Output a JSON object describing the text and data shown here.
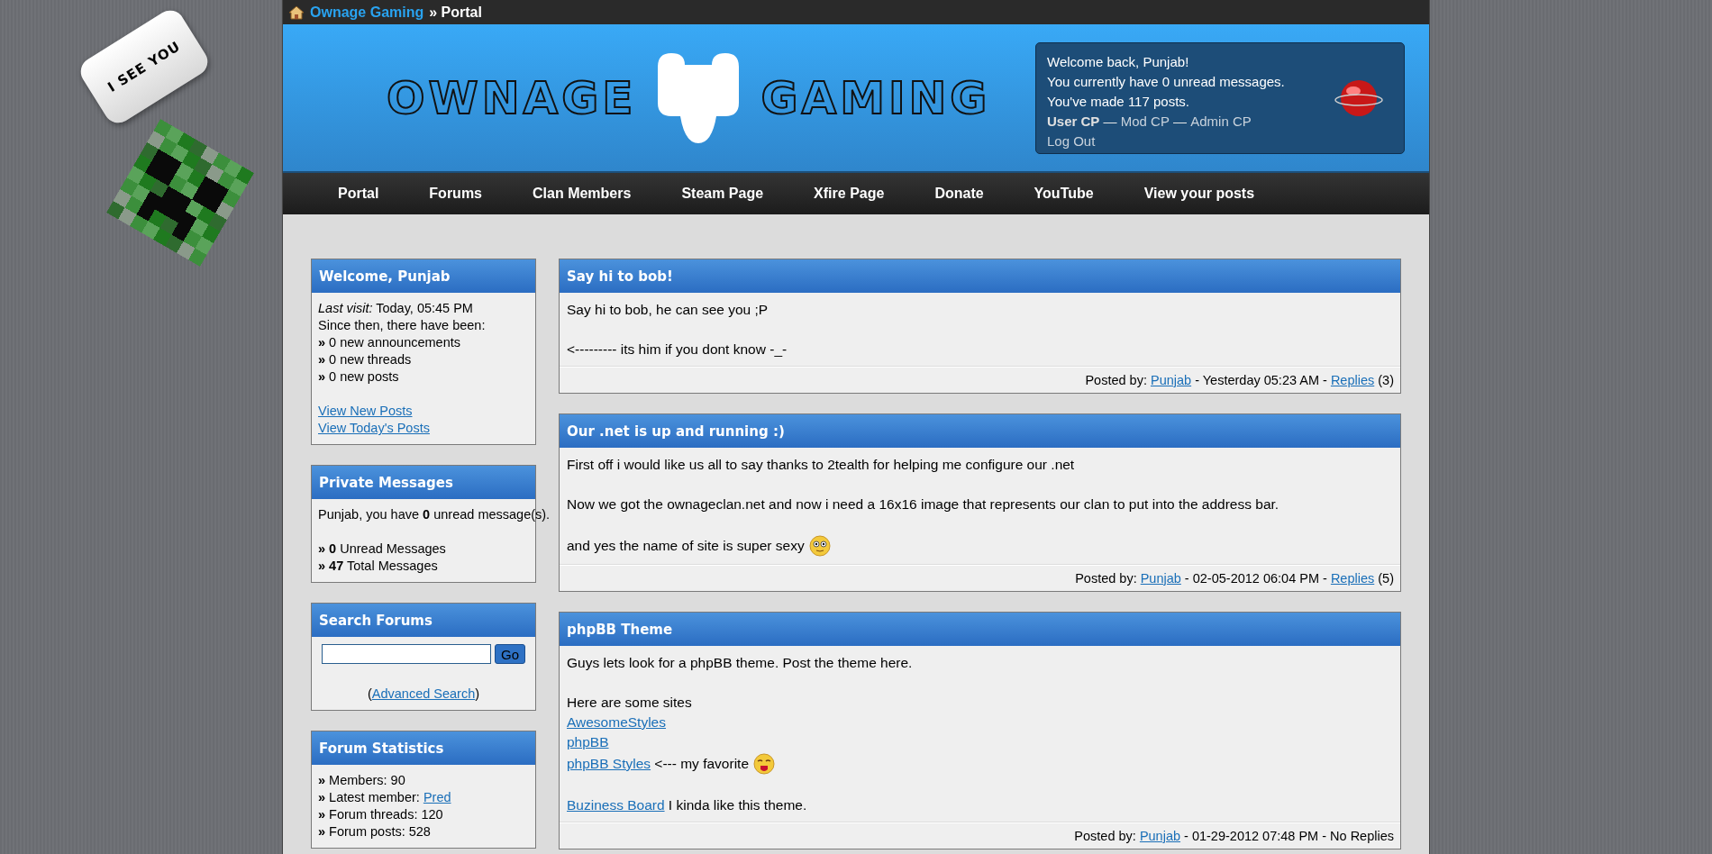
{
  "decor": {
    "bubble_text": "I SEE YOU"
  },
  "breadcrumb": {
    "site": "Ownage Gaming",
    "current": "» Portal"
  },
  "header": {
    "logo_left": "OWNAGE",
    "logo_right": "GAMING",
    "welcome_lines": [
      "Welcome back, Punjab!",
      "You currently have 0 unread messages.",
      "You've made 117 posts."
    ],
    "cp_links": [
      {
        "kind": "strong",
        "text": "User CP"
      },
      {
        "kind": "text",
        "text": " — "
      },
      {
        "kind": "link",
        "text": "Mod CP"
      },
      {
        "kind": "text",
        "text": " — "
      },
      {
        "kind": "link",
        "text": "Admin CP"
      }
    ],
    "logout": "Log Out"
  },
  "nav": [
    "Portal",
    "Forums",
    "Clan Members",
    "Steam Page",
    "Xfire Page",
    "Donate",
    "YouTube",
    "View your posts"
  ],
  "sidebar": [
    {
      "title": "Welcome, Punjab",
      "kind": "lines",
      "groups": [
        [
          [
            {
              "kind": "text",
              "text": "*Last visit:* Today, 05:45 PM"
            }
          ],
          [
            {
              "kind": "text",
              "text": "Since then, there have been:"
            }
          ],
          [
            {
              "kind": "text",
              "text": "**»** 0 new announcements"
            }
          ],
          [
            {
              "kind": "text",
              "text": "**»** 0 new threads"
            }
          ],
          [
            {
              "kind": "text",
              "text": "**»** 0 new posts"
            }
          ]
        ],
        [
          [
            {
              "kind": "link",
              "text": "View New Posts"
            }
          ],
          [
            {
              "kind": "link",
              "text": "View Today's Posts"
            }
          ]
        ]
      ]
    },
    {
      "title": "Private Messages",
      "kind": "lines",
      "groups": [
        [
          [
            {
              "kind": "text",
              "text": "Punjab, you have **0** unread message(s)."
            }
          ]
        ],
        [
          [
            {
              "kind": "text",
              "text": "**» 0** Unread Messages"
            }
          ],
          [
            {
              "kind": "text",
              "text": "**» 47** Total Messages"
            }
          ]
        ]
      ]
    },
    {
      "title": "Search Forums",
      "kind": "search",
      "button": "Go",
      "footer": [
        {
          "kind": "text",
          "text": "("
        },
        {
          "kind": "link",
          "text": "Advanced Search"
        },
        {
          "kind": "text",
          "text": ")"
        }
      ]
    },
    {
      "title": "Forum Statistics",
      "kind": "lines",
      "groups": [
        [
          [
            {
              "kind": "text",
              "text": "**»** Members: 90"
            }
          ],
          [
            {
              "kind": "text",
              "text": "**»** Latest member: "
            },
            {
              "kind": "link",
              "text": "Pred"
            }
          ],
          [
            {
              "kind": "text",
              "text": "**»** Forum threads: 120"
            }
          ],
          [
            {
              "kind": "text",
              "text": "**»** Forum posts: 528"
            }
          ]
        ]
      ]
    }
  ],
  "posts": [
    {
      "title": "Say hi to bob!",
      "paragraphs": [
        [
          [
            {
              "kind": "text",
              "text": "Say hi to bob, he can see you ;P"
            }
          ]
        ],
        [
          [
            {
              "kind": "text",
              "text": "<--------- its him if you dont know -_-"
            }
          ]
        ]
      ],
      "footer": [
        {
          "kind": "text",
          "text": "Posted by: "
        },
        {
          "kind": "link",
          "text": "Punjab"
        },
        {
          "kind": "text",
          "text": " - Yesterday 05:23 AM - "
        },
        {
          "kind": "link",
          "text": "Replies"
        },
        {
          "kind": "text",
          "text": " (3)"
        }
      ]
    },
    {
      "title": "Our .net is up and running :)",
      "paragraphs": [
        [
          [
            {
              "kind": "text",
              "text": "First off i would like us all to say thanks to 2tealth for helping me configure our .net"
            }
          ]
        ],
        [
          [
            {
              "kind": "text",
              "text": "Now we got the ownageclan.net and now i need a 16x16 image that represents our clan to put into the address bar."
            }
          ]
        ],
        [
          [
            {
              "kind": "text",
              "text": "and yes the name of site is super sexy "
            },
            {
              "kind": "smiley"
            }
          ]
        ]
      ],
      "footer": [
        {
          "kind": "text",
          "text": "Posted by: "
        },
        {
          "kind": "link",
          "text": "Punjab"
        },
        {
          "kind": "text",
          "text": " - 02-05-2012 06:04 PM - "
        },
        {
          "kind": "link",
          "text": "Replies"
        },
        {
          "kind": "text",
          "text": " (5)"
        }
      ]
    },
    {
      "title": "phpBB Theme",
      "paragraphs": [
        [
          [
            {
              "kind": "text",
              "text": "Guys lets look for a phpBB theme. Post the theme here."
            }
          ]
        ],
        [
          [
            {
              "kind": "text",
              "text": "Here are some sites"
            }
          ],
          [
            {
              "kind": "link",
              "text": "AwesomeStyles"
            }
          ],
          [
            {
              "kind": "link",
              "text": "phpBB"
            }
          ],
          [
            {
              "kind": "link",
              "text": "phpBB Styles"
            },
            {
              "kind": "text",
              "text": " <--- my favorite "
            },
            {
              "kind": "tongue"
            }
          ]
        ],
        [
          [
            {
              "kind": "link",
              "text": "Buziness Board"
            },
            {
              "kind": "text",
              "text": " I kinda like this theme."
            }
          ]
        ]
      ],
      "footer": [
        {
          "kind": "text",
          "text": "Posted by: "
        },
        {
          "kind": "link",
          "text": "Punjab"
        },
        {
          "kind": "text",
          "text": " - 01-29-2012 07:48 PM - No Replies"
        }
      ]
    }
  ]
}
